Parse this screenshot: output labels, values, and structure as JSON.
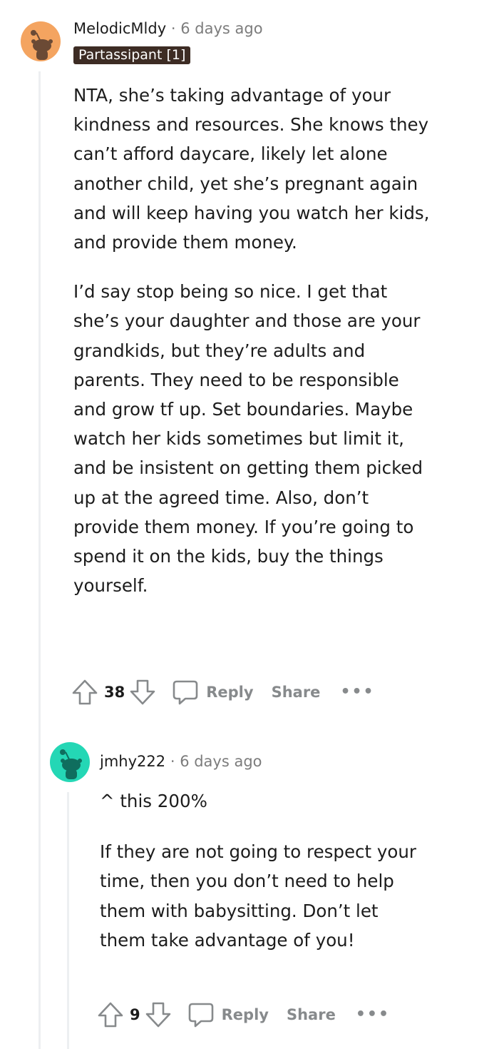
{
  "comments": [
    {
      "username": "MelodicMldy",
      "separator": "·",
      "time": "6 days ago",
      "flair": "Partassipant [1]",
      "paragraphs": [
        "NTA, she’s taking advantage of your kindness and resources. She knows they can’t afford daycare, likely let alone another child, yet she’s pregnant again and will keep having you watch her kids, and provide them money.",
        "I’d say stop being so nice. I get that she’s your daughter and those are your grandkids, but they’re adults and parents. They need to be responsible and grow tf up. Set boundaries. Maybe watch her kids sometimes but limit it, and be insistent on getting them picked up at the agreed time. Also, don’t provide them money. If you’re going to spend it on the kids, buy the things yourself."
      ],
      "score": "38",
      "reply_label": "Reply",
      "share_label": "Share",
      "more_label": "•••",
      "avatar_color": "#f4a460"
    },
    {
      "username": "jmhy222",
      "separator": "·",
      "time": "6 days ago",
      "paragraphs": [
        "^ this 200%",
        "If they are not going to respect your time, then you don’t need to help them with babysitting. Don’t let them take advantage of you!"
      ],
      "score": "9",
      "reply_label": "Reply",
      "share_label": "Share",
      "more_label": "•••",
      "avatar_color": "#24d7b5"
    }
  ],
  "icons": {
    "upvote": "upvote-arrow-icon",
    "downvote": "downvote-arrow-icon",
    "reply": "speech-bubble-icon",
    "more": "ellipsis-icon"
  }
}
